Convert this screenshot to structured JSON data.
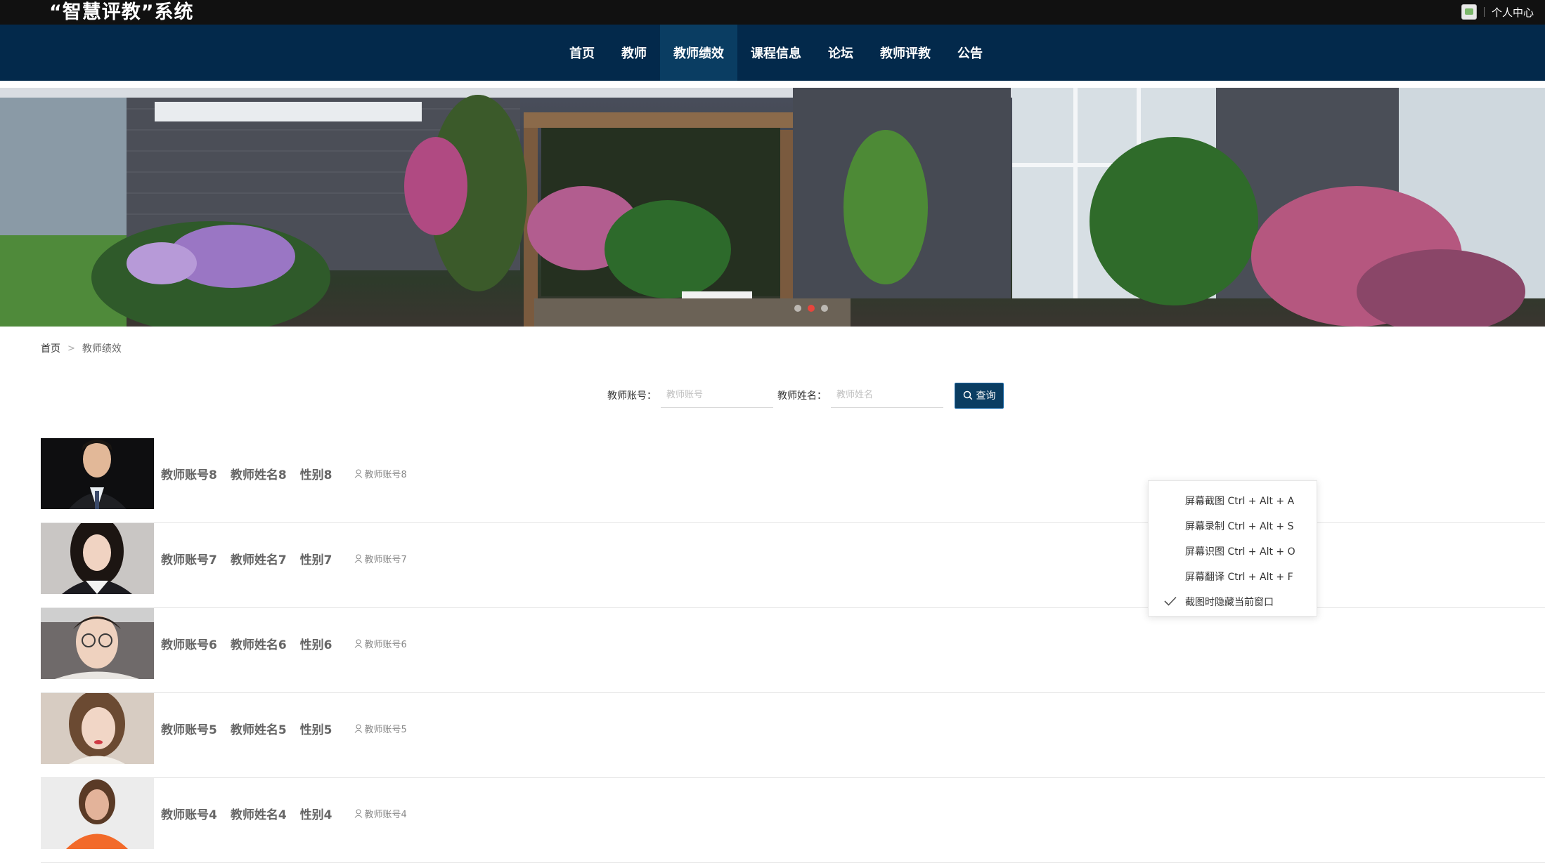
{
  "header": {
    "site_title": "“智慧评教”系统",
    "user_center": "个人中心"
  },
  "nav": {
    "items": [
      {
        "label": "首页",
        "active": false
      },
      {
        "label": "教师",
        "active": false
      },
      {
        "label": "教师绩效",
        "active": true
      },
      {
        "label": "课程信息",
        "active": false
      },
      {
        "label": "论坛",
        "active": false
      },
      {
        "label": "教师评教",
        "active": false
      },
      {
        "label": "公告",
        "active": false
      }
    ]
  },
  "banner": {
    "slide_count": 3,
    "active_slide": 2
  },
  "breadcrumb": {
    "home": "首页",
    "separator": ">",
    "current": "教师绩效"
  },
  "search": {
    "account_label": "教师账号：",
    "account_placeholder": "教师账号",
    "name_label": "教师姓名：",
    "name_placeholder": "教师姓名",
    "button_label": "查询"
  },
  "teachers": [
    {
      "account": "教师账号8",
      "name": "教师姓名8",
      "gender": "性别8",
      "user": "教师账号8"
    },
    {
      "account": "教师账号7",
      "name": "教师姓名7",
      "gender": "性别7",
      "user": "教师账号7"
    },
    {
      "account": "教师账号6",
      "name": "教师姓名6",
      "gender": "性别6",
      "user": "教师账号6"
    },
    {
      "account": "教师账号5",
      "name": "教师姓名5",
      "gender": "性别5",
      "user": "教师账号5"
    },
    {
      "account": "教师账号4",
      "name": "教师姓名4",
      "gender": "性别4",
      "user": "教师账号4"
    }
  ],
  "context_menu": {
    "items": [
      {
        "label": "屏幕截图 Ctrl + Alt + A",
        "checked": false
      },
      {
        "label": "屏幕录制 Ctrl + Alt + S",
        "checked": false
      },
      {
        "label": "屏幕识图 Ctrl + Alt + O",
        "checked": false
      },
      {
        "label": "屏幕翻译 Ctrl + Alt + F",
        "checked": false
      },
      {
        "label": "截图时隐藏当前窗口",
        "checked": true
      }
    ]
  },
  "colors": {
    "topbar": "#111111",
    "nav_bg": "#03294b",
    "nav_active": "#0a3d62",
    "search_button": "#0a3d62",
    "slide_dot_active": "#e8453c"
  }
}
